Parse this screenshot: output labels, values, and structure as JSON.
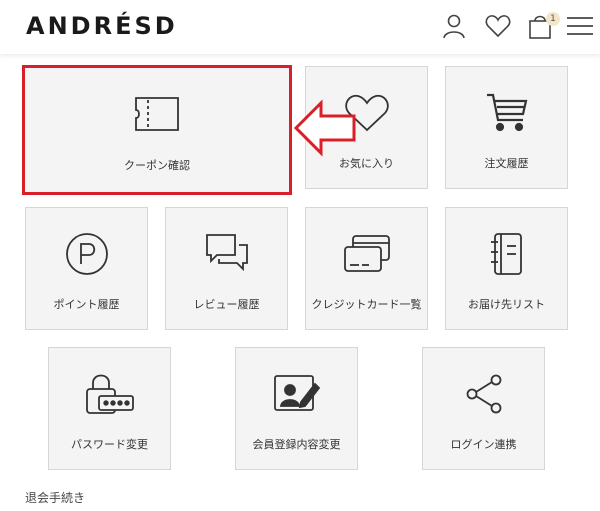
{
  "header": {
    "logo": "ANDRÉSD",
    "cart_count": "1",
    "icons": [
      "user-icon",
      "heart-icon",
      "cart-icon",
      "menu-icon"
    ]
  },
  "menu": {
    "coupon": "クーポン確認",
    "favorites": "お気に入り",
    "order_history": "注文履歴",
    "point_history": "ポイント履歴",
    "review_history": "レビュー履歴",
    "credit_card": "クレジットカード一覧",
    "address_list": "お届け先リスト",
    "password_change": "パスワード変更",
    "member_info": "会員登録内容変更",
    "login_link": "ログイン連携"
  },
  "withdraw": "退会手続き",
  "colors": {
    "highlight": "#d9202a",
    "tile_bg": "#f4f4f4",
    "tile_border": "#d6d6d6"
  }
}
